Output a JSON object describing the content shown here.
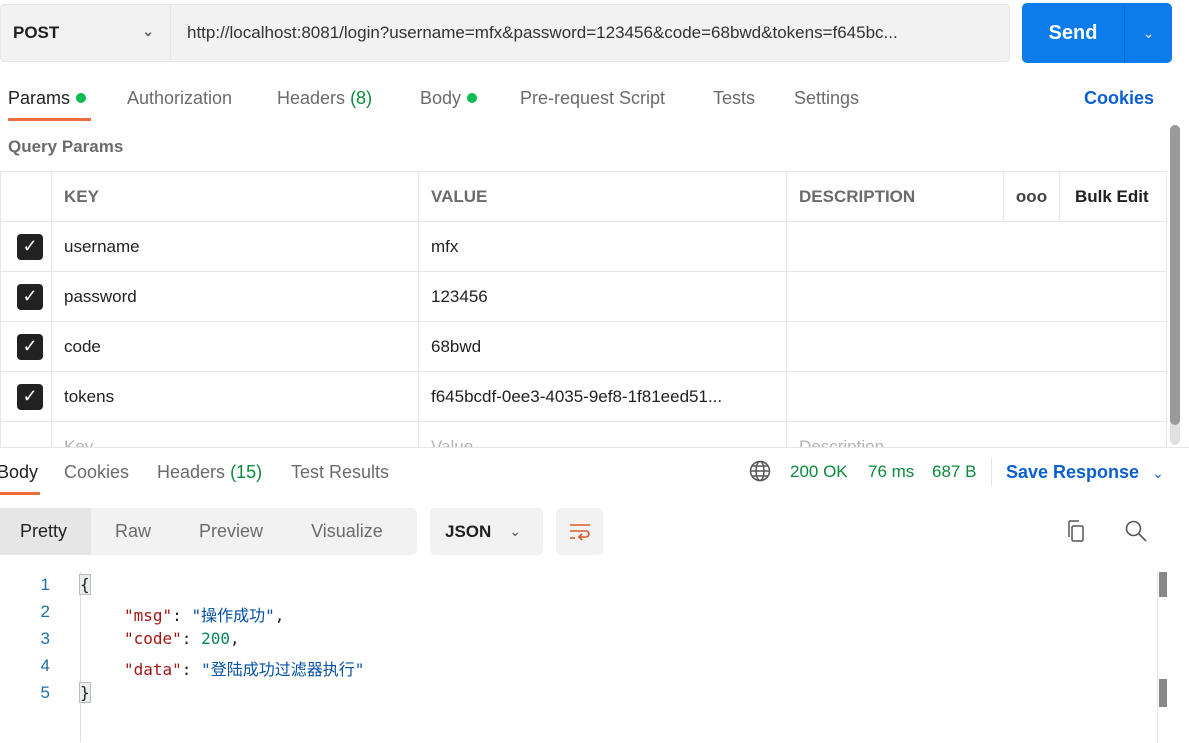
{
  "request": {
    "method": "POST",
    "url": "http://localhost:8081/login?username=mfx&password=123456&code=68bwd&tokens=f645bc...",
    "send_label": "Send"
  },
  "req_tabs": [
    {
      "label": "Params"
    },
    {
      "label": "Authorization"
    },
    {
      "label": "Headers",
      "count": "(8)"
    },
    {
      "label": "Body"
    },
    {
      "label": "Pre-request Script"
    },
    {
      "label": "Tests"
    },
    {
      "label": "Settings"
    }
  ],
  "cookies_label": "Cookies",
  "query_params": {
    "title": "Query Params",
    "headers": [
      "KEY",
      "VALUE",
      "DESCRIPTION"
    ],
    "bulk_edit": "Bulk Edit",
    "more": "ooo",
    "rows": [
      {
        "key": "username",
        "value": "mfx",
        "description": ""
      },
      {
        "key": "password",
        "value": "123456",
        "description": ""
      },
      {
        "key": "code",
        "value": "68bwd",
        "description": ""
      },
      {
        "key": "tokens",
        "value": "f645bcdf-0ee3-4035-9ef8-1f81eed51...",
        "description": ""
      }
    ],
    "placeholder": {
      "key": "Key",
      "value": "Value",
      "description": "Description"
    }
  },
  "resp_tabs": [
    {
      "label": "Body"
    },
    {
      "label": "Cookies"
    },
    {
      "label": "Headers",
      "count": "(15)"
    },
    {
      "label": "Test Results"
    }
  ],
  "response": {
    "status": "200 OK",
    "time": "76 ms",
    "size": "687 B",
    "save_label": "Save Response",
    "views": [
      "Pretty",
      "Raw",
      "Preview",
      "Visualize"
    ],
    "format": "JSON",
    "lines": [
      "1",
      "2",
      "3",
      "4",
      "5"
    ],
    "body": {
      "open": "{",
      "msg_key": "\"msg\"",
      "msg_val": "\"操作成功\"",
      "code_key": "\"code\"",
      "code_val": "200",
      "data_key": "\"data\"",
      "data_val": "\"登陆成功过滤器执行\"",
      "close": "}"
    }
  },
  "colors": {
    "accent": "#0b7cea",
    "tab_underline": "#f26b3a",
    "status": "#0a8a3c"
  }
}
